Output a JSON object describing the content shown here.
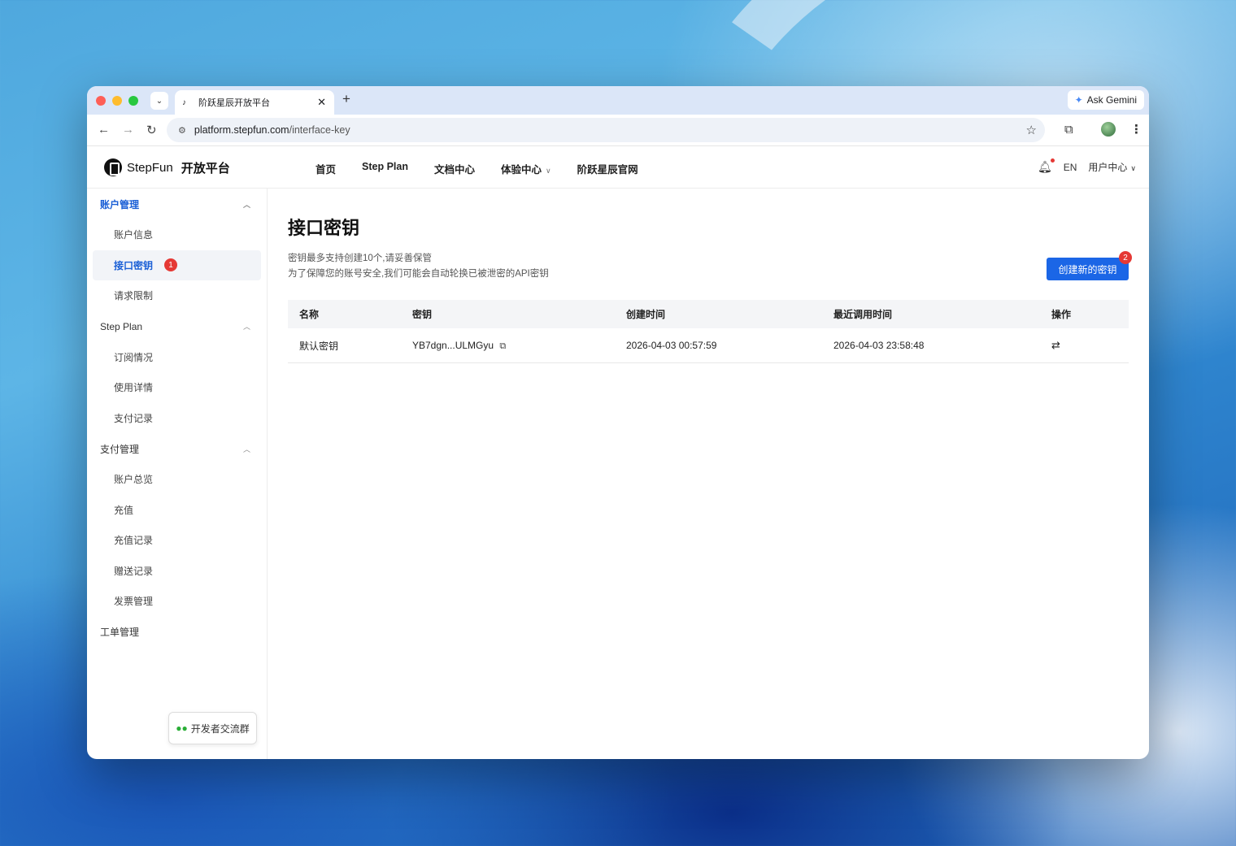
{
  "browser": {
    "tab_title": "阶跃星辰开放平台",
    "tab_favicon": "music-note-icon",
    "new_tab": "+",
    "ask_gemini": "Ask Gemini",
    "url_host": "platform.stepfun.com",
    "url_path": "/interface-key"
  },
  "header": {
    "logo_text": "StepFun",
    "logo_sub": "开放平台",
    "nav": [
      "首页",
      "Step Plan",
      "文档中心",
      "体验中心",
      "阶跃星辰官网"
    ],
    "lang": "EN",
    "user_center": "用户中心"
  },
  "sidebar": {
    "groups": [
      {
        "label": "账户管理",
        "items": [
          "账户信息",
          "接口密钥",
          "请求限制"
        ]
      },
      {
        "label": "Step Plan",
        "items": [
          "订阅情况",
          "使用详情",
          "支付记录"
        ]
      },
      {
        "label": "支付管理",
        "items": [
          "账户总览",
          "充值",
          "充值记录",
          "赠送记录",
          "发票管理"
        ]
      },
      {
        "label": "工单管理",
        "items": []
      }
    ],
    "active_item_badge": "1",
    "dev_group_button": "开发者交流群"
  },
  "main": {
    "title": "接口密钥",
    "desc_line1": "密钥最多支持创建10个,请妥善保管",
    "desc_line2": "为了保障您的账号安全,我们可能会自动轮换已被泄密的API密钥",
    "create_button": "创建新的密钥",
    "create_badge": "2",
    "table": {
      "columns": [
        "名称",
        "密钥",
        "创建时间",
        "最近调用时间",
        "操作"
      ],
      "rows": [
        {
          "name": "默认密钥",
          "key": "YB7dgn...ULMGyu",
          "created": "2026-04-03 00:57:59",
          "last_used": "2026-04-03 23:58:48"
        }
      ]
    }
  },
  "colors": {
    "accent": "#1b66e6",
    "badge": "#e53935",
    "active_text": "#1a5fd6"
  }
}
